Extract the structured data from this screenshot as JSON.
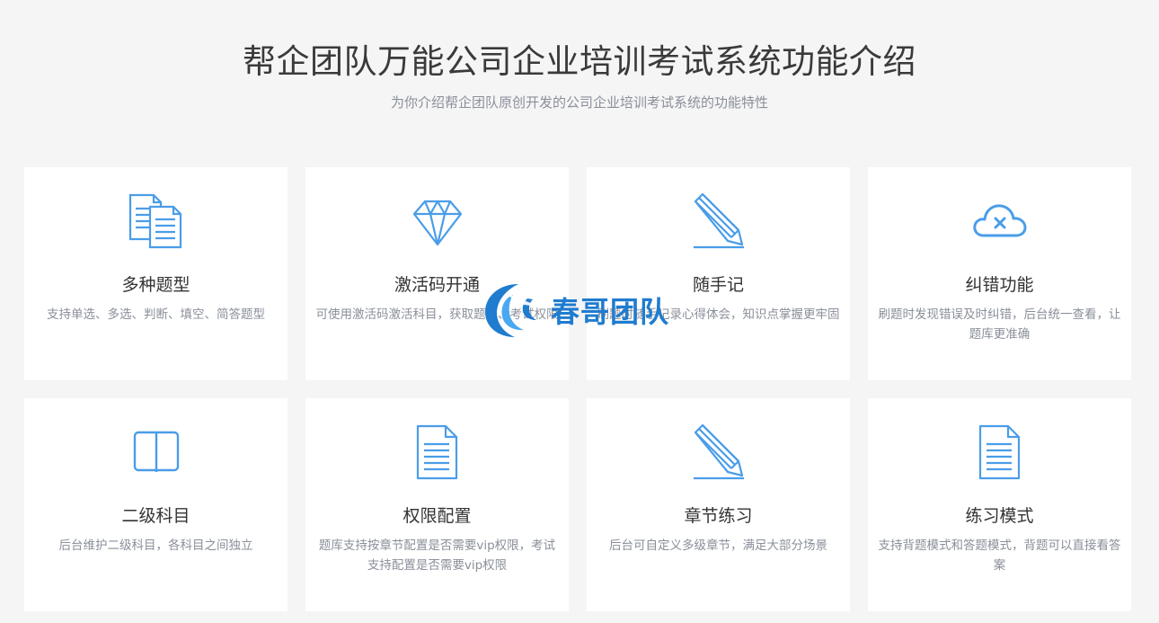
{
  "header": {
    "title": "帮企团队万能公司企业培训考试系统功能介绍",
    "subtitle": "为你介绍帮企团队原创开发的公司企业培训考试系统的功能特性"
  },
  "colors": {
    "accent": "#4a9de8",
    "title": "#333333",
    "muted": "#8a8f99",
    "watermark": "#1f7ccf"
  },
  "features": [
    {
      "icon": "documents-icon",
      "title": "多种题型",
      "desc": "支持单选、多选、判断、填空、简答题型"
    },
    {
      "icon": "diamond-icon",
      "title": "激活码开通",
      "desc": "可使用激活码激活科目，获取题库、考试权限"
    },
    {
      "icon": "pencil-icon",
      "title": "随手记",
      "desc": "刷题时随手记录心得体会，知识点掌握更牢固"
    },
    {
      "icon": "cloud-error-icon",
      "title": "纠错功能",
      "desc": "刷题时发现错误及时纠错，后台统一查看，让题库更准确"
    },
    {
      "icon": "book-icon",
      "title": "二级科目",
      "desc": "后台维护二级科目，各科目之间独立"
    },
    {
      "icon": "document-icon",
      "title": "权限配置",
      "desc": "题库支持按章节配置是否需要vip权限，考试支持配置是否需要vip权限"
    },
    {
      "icon": "pencil-icon",
      "title": "章节练习",
      "desc": "后台可自定义多级章节，满足大部分场景"
    },
    {
      "icon": "document-icon",
      "title": "练习模式",
      "desc": "支持背题模式和答题模式，背题可以直接看答案"
    }
  ],
  "watermark": {
    "text": "春哥团队"
  }
}
